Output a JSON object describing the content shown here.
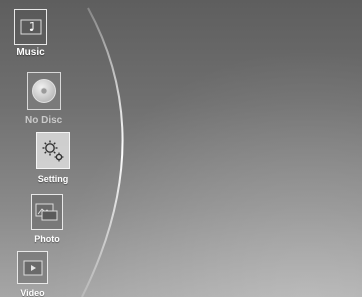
{
  "menu": {
    "items": [
      {
        "id": "music",
        "label": "Music",
        "icon": "music-note-icon",
        "state": "enabled"
      },
      {
        "id": "nodisc",
        "label": "No Disc",
        "icon": "disc-icon",
        "state": "disabled"
      },
      {
        "id": "setting",
        "label": "Setting",
        "icon": "gears-icon",
        "state": "selected"
      },
      {
        "id": "photo",
        "label": "Photo",
        "icon": "photo-icon",
        "state": "enabled"
      },
      {
        "id": "video",
        "label": "Video",
        "icon": "video-icon",
        "state": "enabled"
      }
    ]
  },
  "colors": {
    "background_top": "#5e5e5e",
    "background_bottom": "#a6a6a6",
    "label": "#ffffff",
    "label_disabled": "#c9c9c9",
    "selected_icon_background": "#ebebeb"
  }
}
